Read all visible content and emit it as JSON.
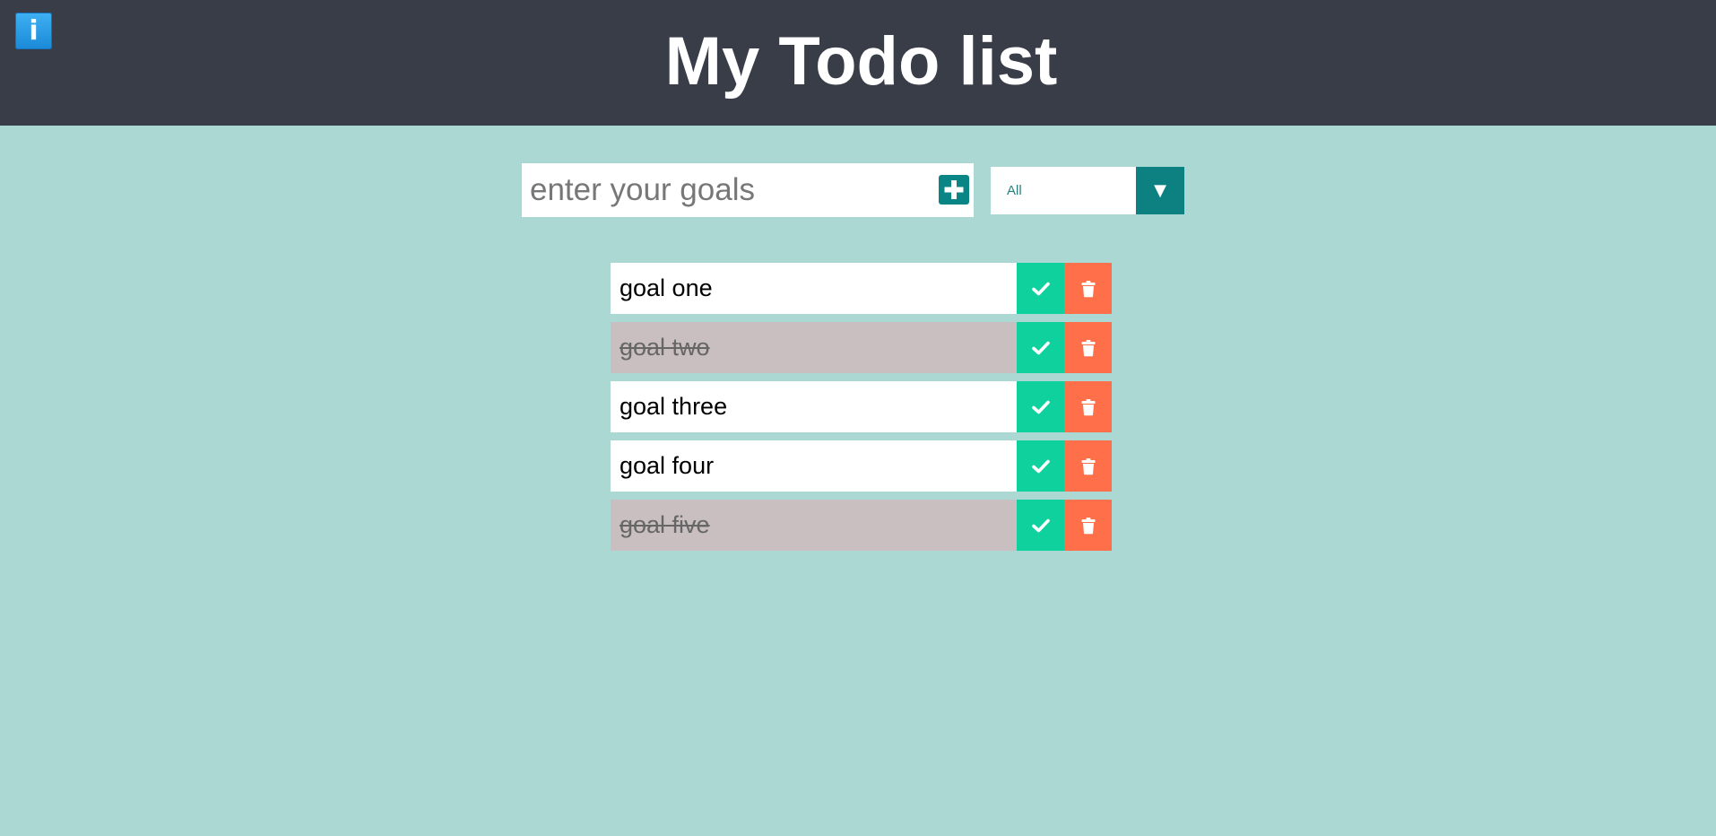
{
  "app": {
    "title": "My Todo list"
  },
  "header": {
    "info_icon_glyph": "i",
    "info_icon": "info-icon"
  },
  "add_goal": {
    "placeholder": "enter your goals",
    "value": "",
    "add_icon": "plus-square-icon"
  },
  "filter": {
    "selected": "All",
    "arrow_glyph": "▼"
  },
  "todos": [
    {
      "text": "goal one",
      "completed": false
    },
    {
      "text": "goal two",
      "completed": true
    },
    {
      "text": "goal three",
      "completed": false
    },
    {
      "text": "goal four",
      "completed": false
    },
    {
      "text": "goal five",
      "completed": true
    }
  ],
  "actions": {
    "check_icon": "check-icon",
    "trash_icon": "trash-icon"
  },
  "colors": {
    "header_bg": "#393d48",
    "page_bg": "#abd8d3",
    "accent": "#0d8181",
    "check_bg": "#0fd19d",
    "trash_bg": "#ff704a",
    "completed_bg": "#c9bfc0"
  }
}
